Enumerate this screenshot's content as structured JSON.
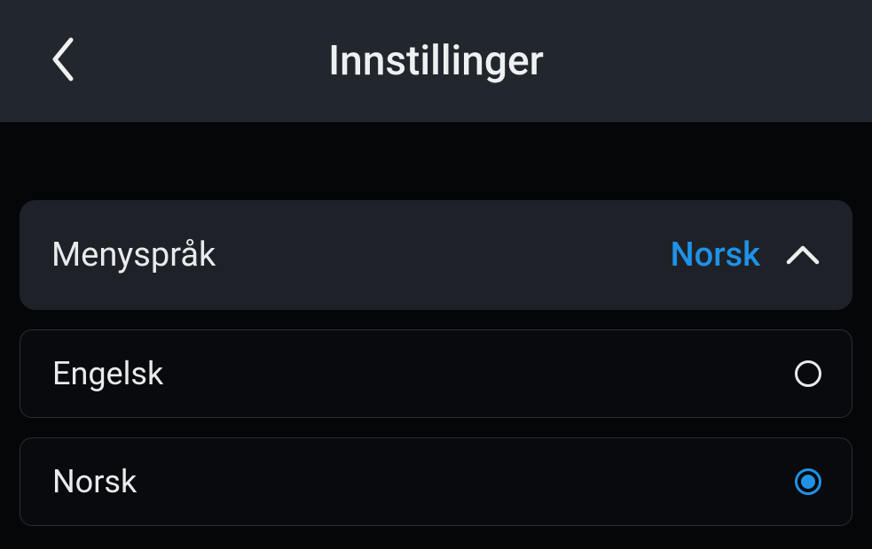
{
  "header": {
    "title": "Innstillinger"
  },
  "menu_language": {
    "label": "Menyspråk",
    "selected": "Norsk",
    "options": [
      {
        "label": "Engelsk",
        "selected": false
      },
      {
        "label": "Norsk",
        "selected": true
      }
    ]
  }
}
